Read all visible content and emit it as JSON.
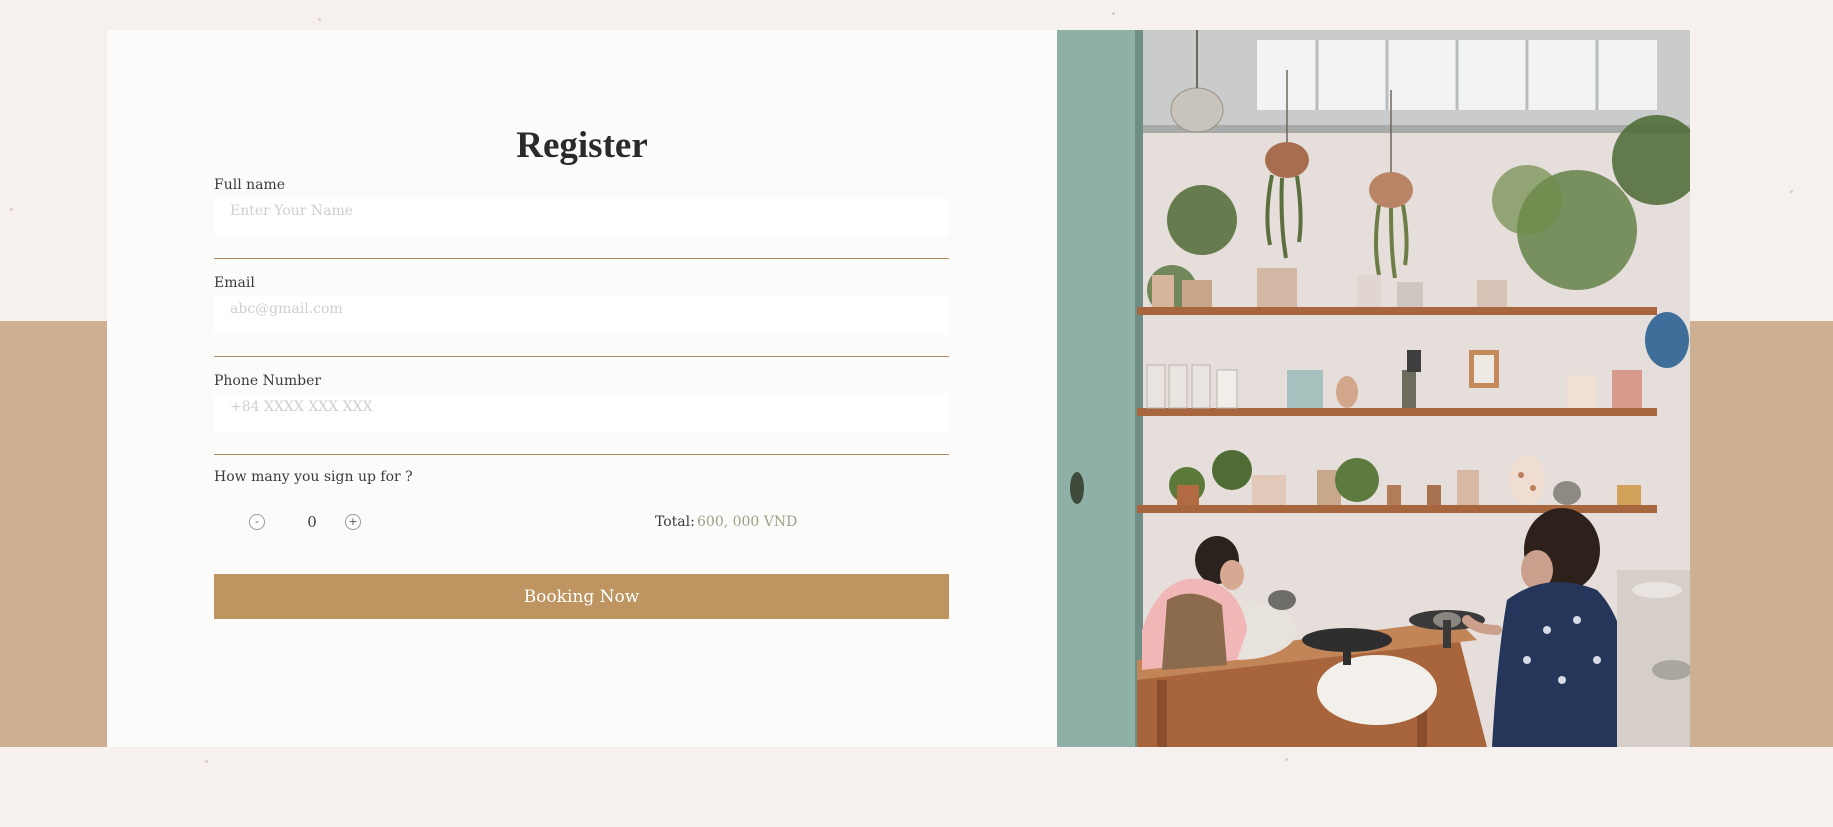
{
  "form": {
    "title": "Register",
    "fields": [
      {
        "label": "Full name",
        "placeholder": "Enter Your Name",
        "value": ""
      },
      {
        "label": "Email",
        "placeholder": "abc@gmail.com",
        "value": ""
      },
      {
        "label": "Phone Number",
        "placeholder": "+84 XXXX XXX XXX",
        "value": ""
      }
    ],
    "signup": {
      "label": "How many you sign up for ?",
      "minus": "-",
      "plus": "+",
      "quantity": "0",
      "total_label": "Total:",
      "total_value": "600, 000 VND"
    },
    "submit_label": "Booking Now"
  },
  "photo": {
    "subject": "pottery-workshop-photo"
  },
  "colors": {
    "page_background": "#f6f1ee",
    "band": "#cdb092",
    "card": "#fbfbfa",
    "accent": "#be9560",
    "divider": "#b08a5e",
    "total_value": "#9f9d84"
  }
}
